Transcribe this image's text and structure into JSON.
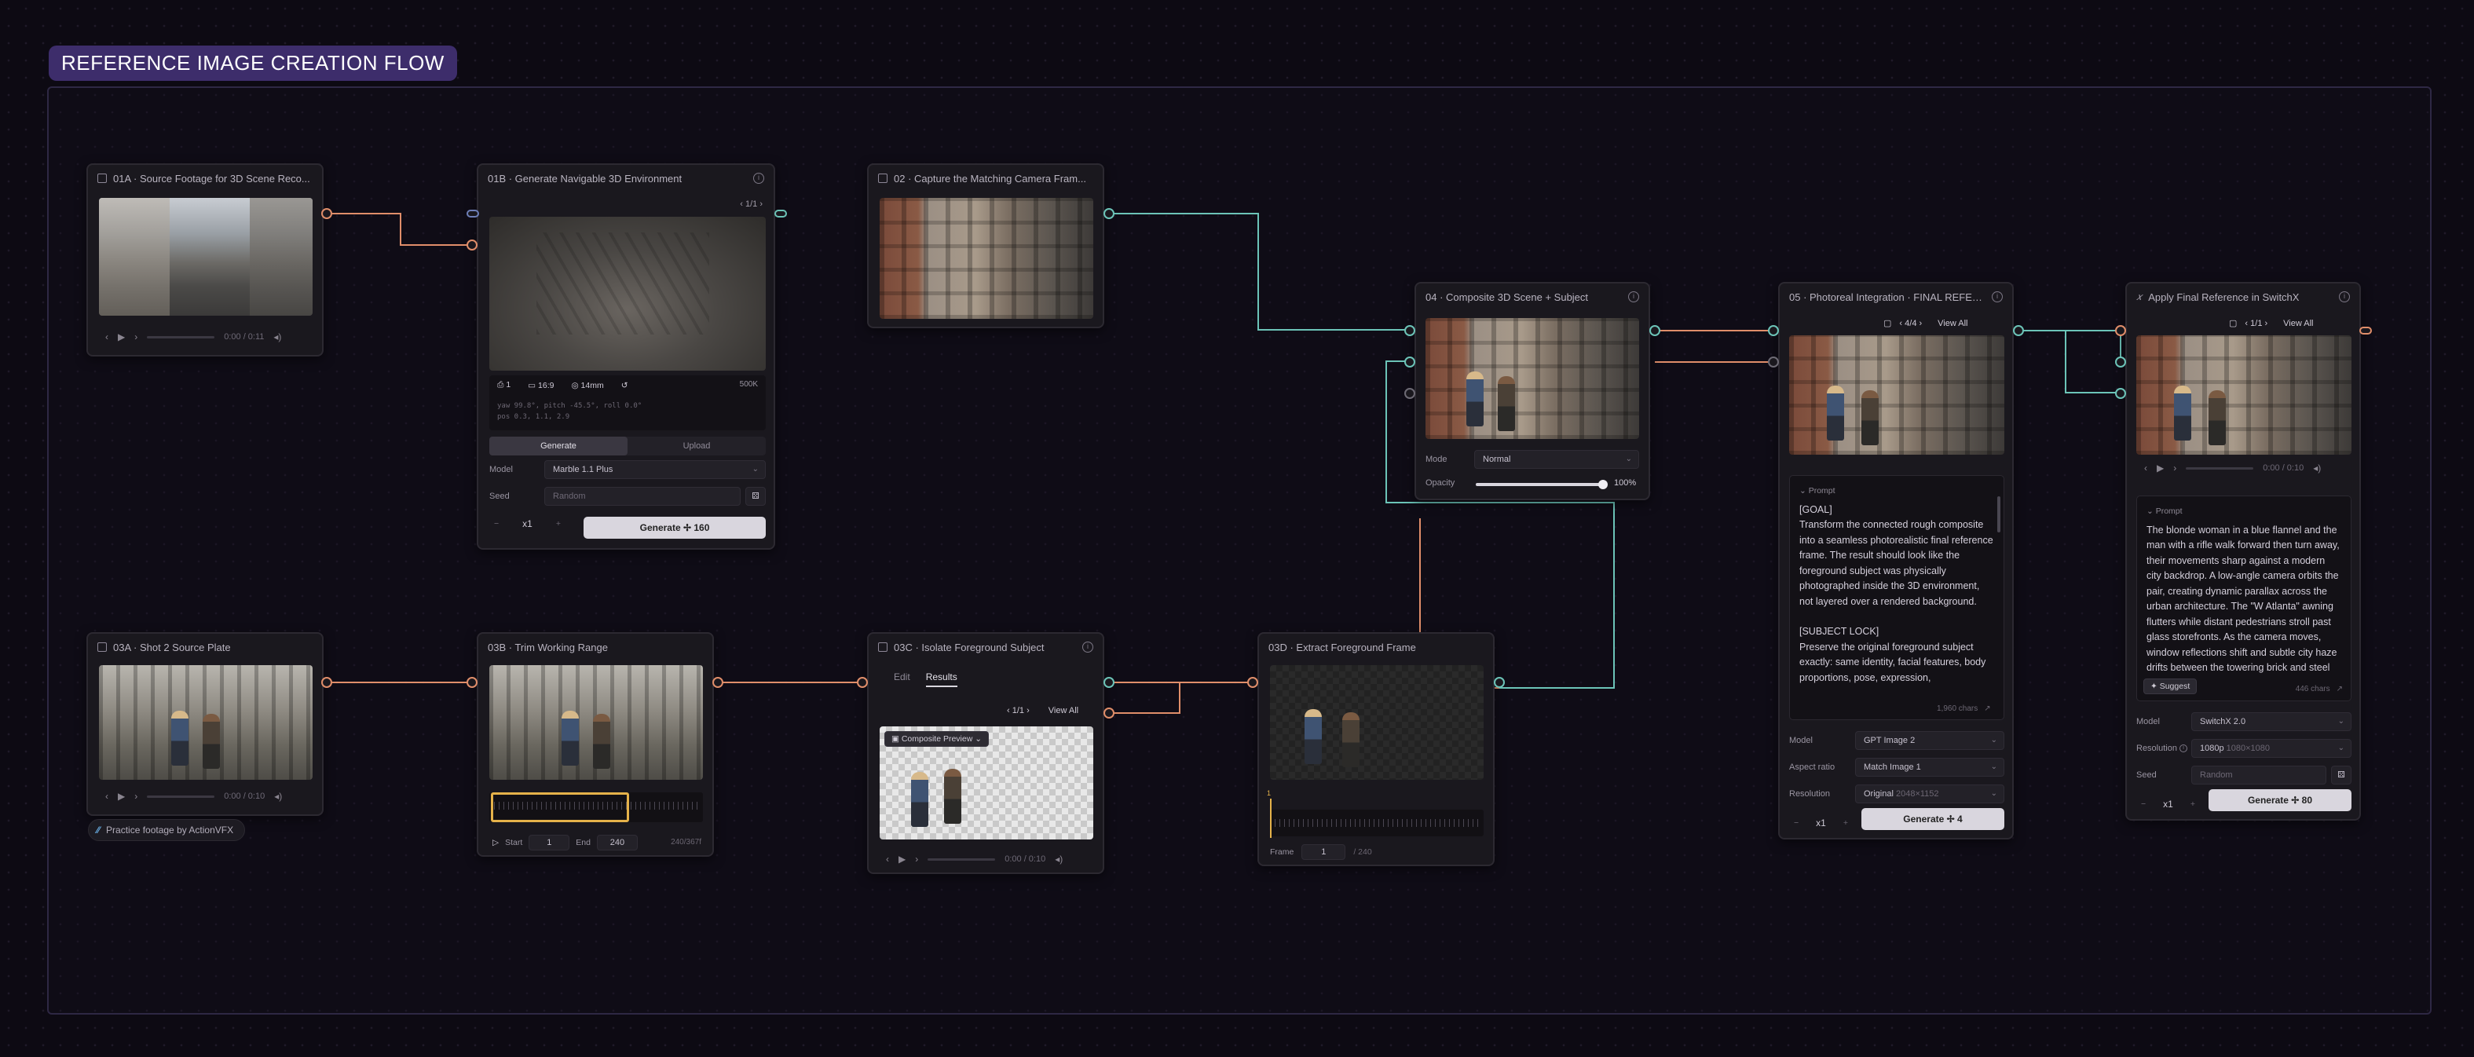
{
  "group": {
    "title": "REFERENCE IMAGE CREATION FLOW"
  },
  "nodes": {
    "n01a": {
      "title": "01A · Source Footage for 3D Scene Reco...",
      "time": "0:00 / 0:11"
    },
    "n01b": {
      "title": "01B · Generate Navigable 3D Environment",
      "pager": "1/1",
      "cam": {
        "count": "1",
        "aspect": "16:9",
        "lens": "14mm",
        "res": "500K"
      },
      "coords": {
        "line1": "yaw 99.8°, pitch -45.5°, roll 0.0°",
        "line2": "pos 0.3, 1.1, 2.9"
      },
      "tabs": [
        "Generate",
        "Upload"
      ],
      "model_label": "Model",
      "model": "Marble 1.1 Plus",
      "seed_label": "Seed",
      "seed": "Random",
      "count": "x1",
      "button": "Generate  ✢ 160"
    },
    "n02": {
      "title": "02 · Capture the Matching Camera Fram..."
    },
    "n03a": {
      "title": "03A · Shot 2 Source Plate",
      "time": "0:00 / 0:10"
    },
    "credit": "Practice footage by ActionVFX",
    "n03b": {
      "title": "03B · Trim Working Range",
      "start_label": "Start",
      "start": "1",
      "end_label": "End",
      "end": "240",
      "range": "240/367f"
    },
    "n03c": {
      "title": "03C · Isolate Foreground Subject",
      "tabs": [
        "Edit",
        "Results"
      ],
      "pager": "1/1",
      "view_all": "View All",
      "chip": "Composite Preview",
      "time": "0:00 / 0:10"
    },
    "n03d": {
      "title": "03D · Extract Foreground Frame",
      "marker": "1",
      "frame_label": "Frame",
      "frame": "1",
      "frame_total": "/ 240"
    },
    "n04": {
      "title": "04 · Composite 3D Scene + Subject",
      "mode_label": "Mode",
      "mode": "Normal",
      "opacity_label": "Opacity",
      "opacity": "100%",
      "opacity_value": 1.0
    },
    "n05": {
      "title": "05 · Photoreal Integration · FINAL REFER...",
      "pager": "4/4",
      "view_all": "View All",
      "prompt_label": "Prompt",
      "prompt": [
        "[GOAL]",
        "Transform the connected rough composite into a seamless photorealistic final reference frame. The result should look like the foreground subject was physically photographed inside the 3D environment, not layered over a rendered background.",
        "",
        "[SUBJECT LOCK]",
        "Preserve the original foreground subject exactly: same identity, facial features, body proportions, pose, expression,"
      ],
      "chars": "1,960 chars",
      "model_label": "Model",
      "model": "GPT Image 2",
      "aspect_label": "Aspect ratio",
      "aspect": "Match Image 1",
      "res_label": "Resolution",
      "res": "Original",
      "res_hint": "2048×1152",
      "count": "x1",
      "button": "Generate  ✢ 4"
    },
    "n06": {
      "title": "Apply Final Reference in SwitchX",
      "pager": "1/1",
      "view_all": "View All",
      "time": "0:00 / 0:10",
      "prompt_label": "Prompt",
      "prompt": "The blonde woman in a blue flannel and the man with a rifle walk forward then turn away, their movements sharp against a modern city backdrop. A low-angle camera orbits the pair, creating dynamic parallax across the urban architecture. The \"W Atlanta\" awning flutters while distant pedestrians stroll past glass storefronts. As the camera moves, window reflections shift and subtle city haze drifts between the towering brick and steel buildings.",
      "suggest": "Suggest",
      "chars": "446 chars",
      "model_label": "Model",
      "model": "SwitchX 2.0",
      "res_label": "Resolution",
      "res": "1080p",
      "res_hint": "1080×1080",
      "seed_label": "Seed",
      "seed": "Random",
      "count": "x1",
      "button": "Generate  ✢ 80"
    }
  },
  "colors": {
    "accent": "#3d2d6b",
    "wire_orange": "#e08e6a",
    "wire_teal": "#6cc4b8",
    "yellow": "#e5b24a"
  }
}
